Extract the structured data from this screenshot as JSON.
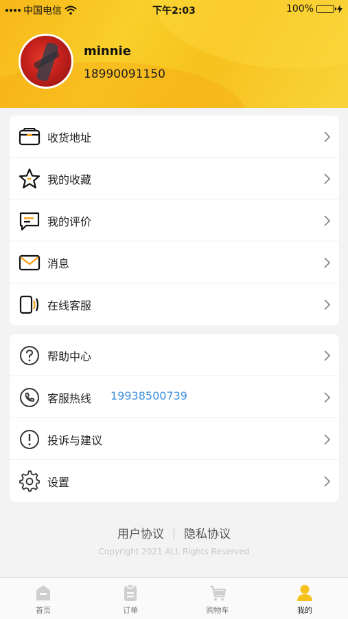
{
  "status_bar": {
    "carrier": "中国电信",
    "time": "下午2:03",
    "battery": "100%"
  },
  "profile": {
    "username": "minnie",
    "phone": "18990091150"
  },
  "menu_group1": [
    {
      "label": "收货地址",
      "icon": "address-box-icon"
    },
    {
      "label": "我的收藏",
      "icon": "star-icon"
    },
    {
      "label": "我的评价",
      "icon": "comment-icon"
    },
    {
      "label": "消息",
      "icon": "envelope-icon"
    },
    {
      "label": "在线客服",
      "icon": "customer-service-icon"
    }
  ],
  "menu_group2": [
    {
      "label": "帮助中心",
      "icon": "help-icon"
    },
    {
      "label": "客服热线",
      "value": "19938500739",
      "icon": "phone-icon"
    },
    {
      "label": "投诉与建议",
      "icon": "alert-icon"
    },
    {
      "label": "设置",
      "icon": "settings-gear-icon"
    }
  ],
  "footer": {
    "user_agreement": "用户协议",
    "privacy_policy": "隐私协议",
    "copyright": "Copyright 2021 ALL Rights Reserved"
  },
  "tabs": [
    {
      "label": "首页",
      "icon": "home-icon",
      "active": false
    },
    {
      "label": "订单",
      "icon": "order-icon",
      "active": false
    },
    {
      "label": "购物车",
      "icon": "cart-icon",
      "active": false
    },
    {
      "label": "我的",
      "icon": "profile-icon",
      "active": true
    }
  ],
  "colors": {
    "accent": "#f7c21e",
    "link_blue": "#3f8fe0",
    "icon_orange": "#f6a21a"
  }
}
